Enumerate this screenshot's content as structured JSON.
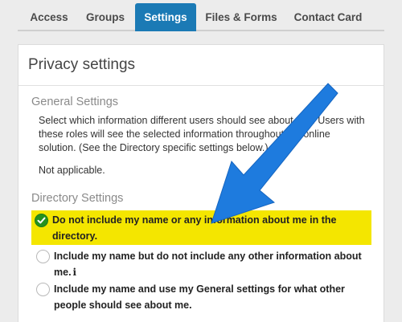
{
  "tabs": [
    {
      "label": "Access",
      "active": false
    },
    {
      "label": "Groups",
      "active": false
    },
    {
      "label": "Settings",
      "active": true
    },
    {
      "label": "Files & Forms",
      "active": false
    },
    {
      "label": "Contact Card",
      "active": false
    }
  ],
  "panel": {
    "title": "Privacy settings",
    "general": {
      "heading": "General Settings",
      "description": "Select which information different users should see about you. Users with these roles will see the selected information throughout the online solution. (See the Directory specific settings below.)",
      "value": "Not applicable."
    },
    "directory": {
      "heading": "Directory Settings",
      "options": [
        {
          "label": "Do not include my name or any information about me in the directory.",
          "selected": true
        },
        {
          "label": "Include my name but do not include any other information about me.",
          "selected": false,
          "info_icon": "info-icon"
        },
        {
          "label": "Include my name and use my General settings for what other people should see about me.",
          "selected": false
        }
      ]
    }
  },
  "colors": {
    "active_tab": "#1b7ab5",
    "highlight": "#f4e600",
    "check": "#26921f",
    "arrow": "#1e7bde"
  }
}
